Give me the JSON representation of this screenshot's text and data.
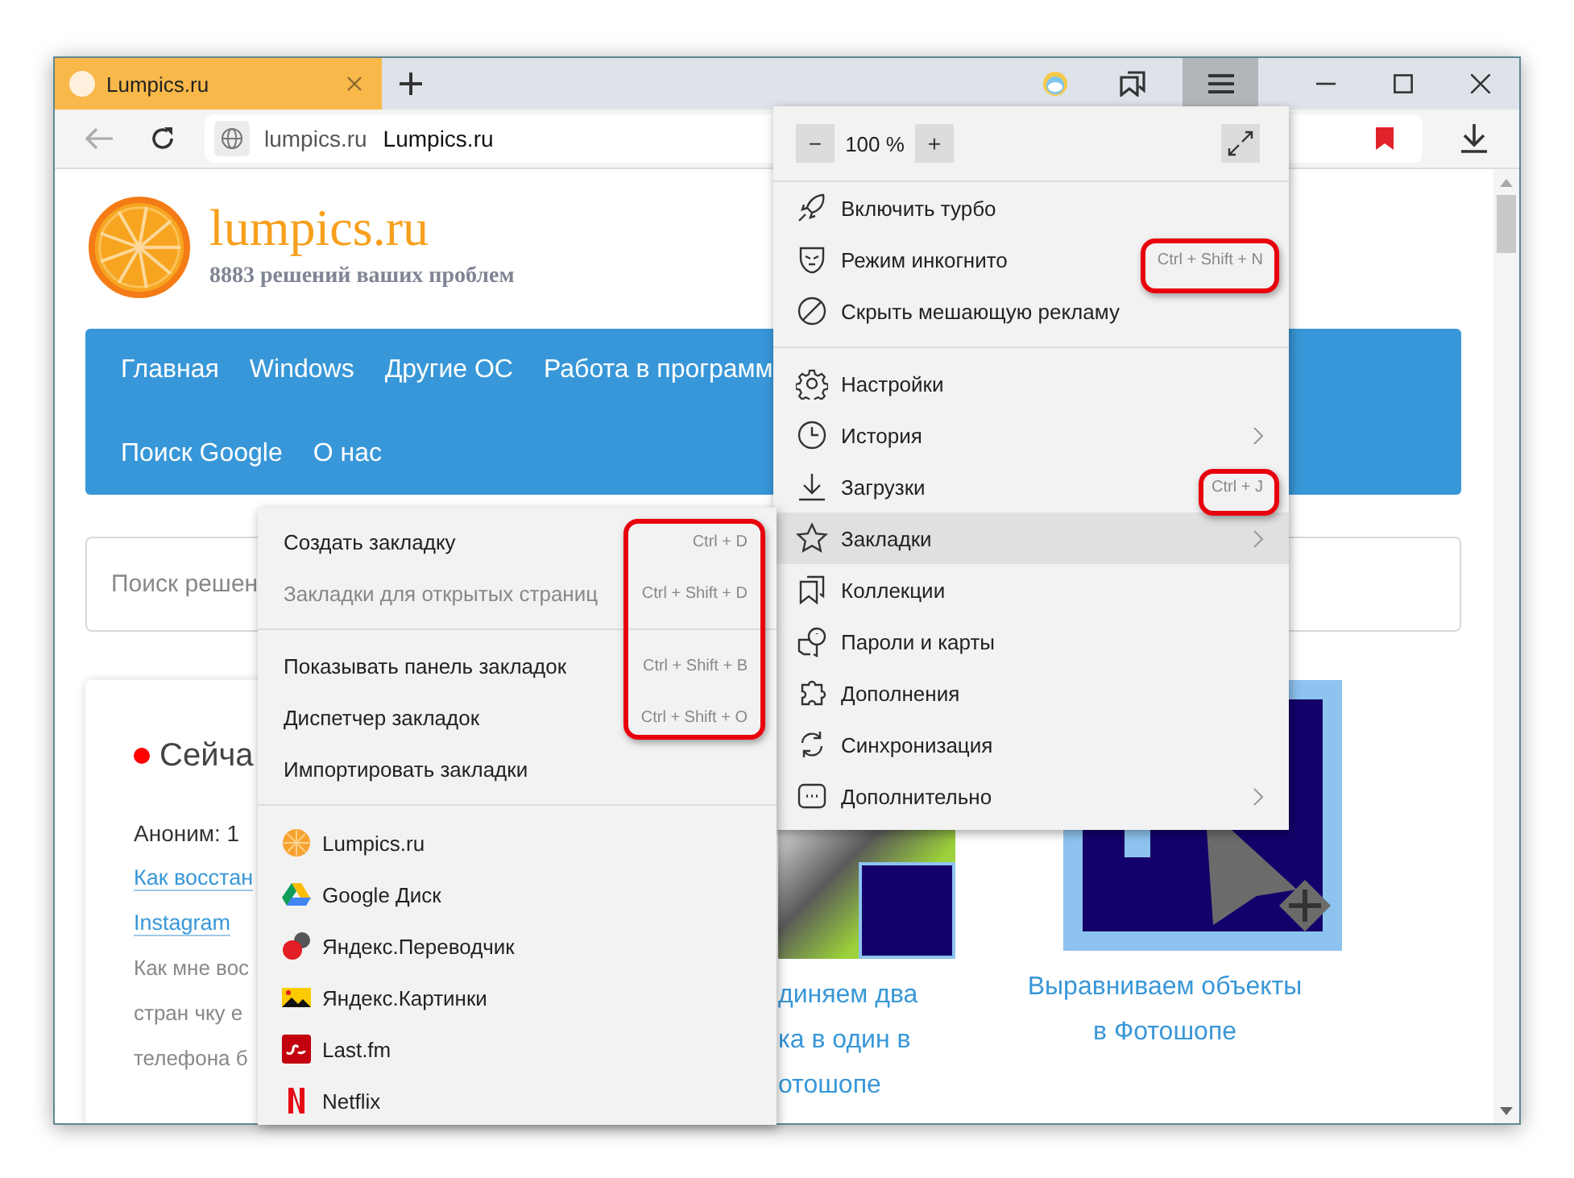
{
  "tab": {
    "title": "Lumpics.ru"
  },
  "address_bar": {
    "domain": "lumpics.ru",
    "page_title": "Lumpics.ru"
  },
  "site": {
    "title": "lumpics.ru",
    "tagline": "8883 решений ваших проблем",
    "nav_rows": [
      [
        "Главная",
        "Windows",
        "Другие ОС",
        "Работа в программ"
      ],
      [
        "Поиск Google",
        "О нас"
      ]
    ],
    "search": {
      "placeholder": "Поиск решен"
    },
    "live_card": {
      "heading": "Сейча",
      "comment_author": "Аноним: 1",
      "links": [
        "Как восстан",
        "Instagram"
      ],
      "excerpt_lines": [
        "Как мне вос",
        "стран чку е",
        "телефона б"
      ]
    },
    "articles": [
      {
        "title_lines": [
          "диняем два",
          "ка в один в",
          "отошопе"
        ]
      },
      {
        "title_lines": [
          "Выравниваем объекты",
          "в Фотошопе"
        ]
      }
    ]
  },
  "main_menu": {
    "zoom": {
      "minus": "−",
      "value": "100 %",
      "plus": "+"
    },
    "sections": [
      [
        {
          "label": "Включить турбо",
          "has_submenu": false,
          "highlighted": false
        },
        {
          "label": "Режим инкогнито",
          "shortcut": "Ctrl + Shift + N",
          "has_submenu": false,
          "highlighted": false
        },
        {
          "label": "Скрыть мешающую рекламу",
          "has_submenu": false,
          "highlighted": false
        }
      ],
      [
        {
          "label": "Настройки",
          "has_submenu": false,
          "highlighted": false
        },
        {
          "label": "История",
          "has_submenu": true,
          "highlighted": false
        },
        {
          "label": "Загрузки",
          "shortcut": "Ctrl + J",
          "has_submenu": false,
          "highlighted": false
        },
        {
          "label": "Закладки",
          "has_submenu": true,
          "highlighted": true
        },
        {
          "label": "Коллекции",
          "has_submenu": false,
          "highlighted": false
        },
        {
          "label": "Пароли и карты",
          "has_submenu": false,
          "highlighted": false
        },
        {
          "label": "Дополнения",
          "has_submenu": false,
          "highlighted": false
        },
        {
          "label": "Синхронизация",
          "has_submenu": false,
          "highlighted": false
        },
        {
          "label": "Дополнительно",
          "has_submenu": true,
          "highlighted": false
        }
      ]
    ]
  },
  "bookmarks_menu": {
    "sections": [
      [
        {
          "label": "Создать закладку",
          "shortcut": "Ctrl + D",
          "disabled": false
        },
        {
          "label": "Закладки для открытых страниц",
          "shortcut": "Ctrl + Shift + D",
          "disabled": true
        }
      ],
      [
        {
          "label": "Показывать панель закладок",
          "shortcut": "Ctrl + Shift + B",
          "disabled": false
        },
        {
          "label": "Диспетчер закладок",
          "shortcut": "Ctrl + Shift + O",
          "disabled": false
        },
        {
          "label": "Импортировать закладки",
          "disabled": false
        }
      ]
    ],
    "bookmarks": [
      {
        "label": "Lumpics.ru"
      },
      {
        "label": "Google Диск"
      },
      {
        "label": "Яндекс.Переводчик"
      },
      {
        "label": "Яндекс.Картинки"
      },
      {
        "label": "Last.fm"
      },
      {
        "label": "Netflix"
      }
    ]
  }
}
